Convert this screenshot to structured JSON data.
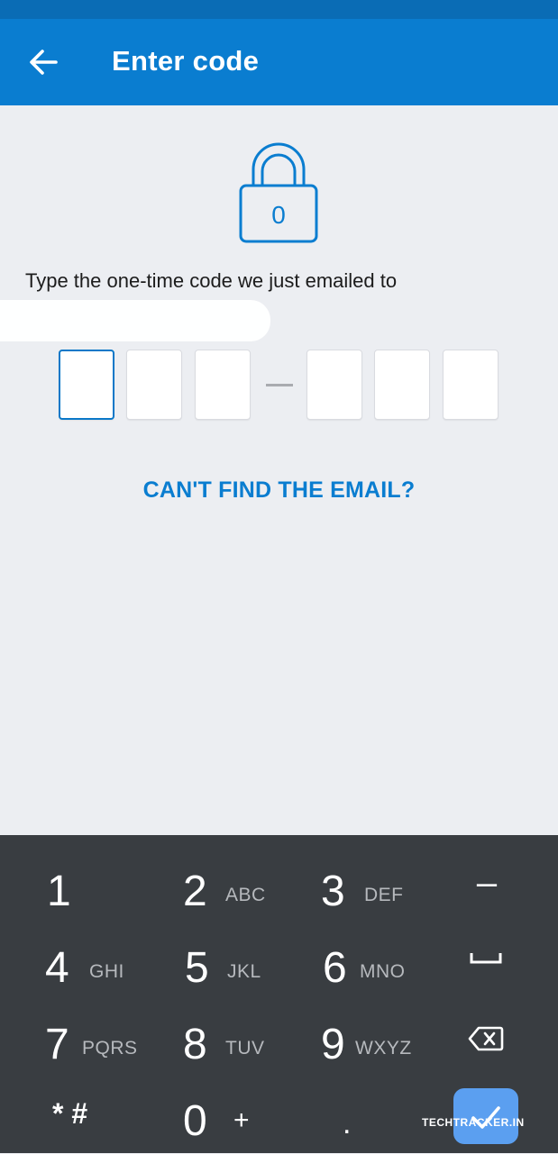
{
  "app_bar": {
    "title": "Enter code",
    "back_icon": "arrow-left-icon"
  },
  "lock": {
    "icon": "lock-icon",
    "digit": "0"
  },
  "instruction": "Type the one-time code we just emailed to",
  "code_input": {
    "boxes": [
      "",
      "",
      "",
      "",
      "",
      ""
    ],
    "separator": "–",
    "active_index": 0
  },
  "cant_find_link": "CAN'T FIND THE EMAIL?",
  "keyboard": {
    "keys": [
      {
        "num": "1",
        "letters": ""
      },
      {
        "num": "2",
        "letters": "ABC"
      },
      {
        "num": "3",
        "letters": "DEF"
      },
      {
        "num": "4",
        "letters": "GHI"
      },
      {
        "num": "5",
        "letters": "JKL"
      },
      {
        "num": "6",
        "letters": "MNO"
      },
      {
        "num": "7",
        "letters": "PQRS"
      },
      {
        "num": "8",
        "letters": "TUV"
      },
      {
        "num": "9",
        "letters": "WXYZ"
      },
      {
        "num": "0",
        "letters": "+"
      }
    ],
    "symbols": {
      "minus": "–",
      "star_hash": "* #",
      "dot": "."
    },
    "icons": [
      "space-icon",
      "backspace-icon",
      "check-icon"
    ]
  },
  "watermark": "TECHTRACKER.IN",
  "colors": {
    "primary": "#0a7dd0",
    "status_bar": "#0a6cb5",
    "background": "#eceef2",
    "keyboard": "#393d41",
    "accent_button": "#5b9ff0"
  }
}
